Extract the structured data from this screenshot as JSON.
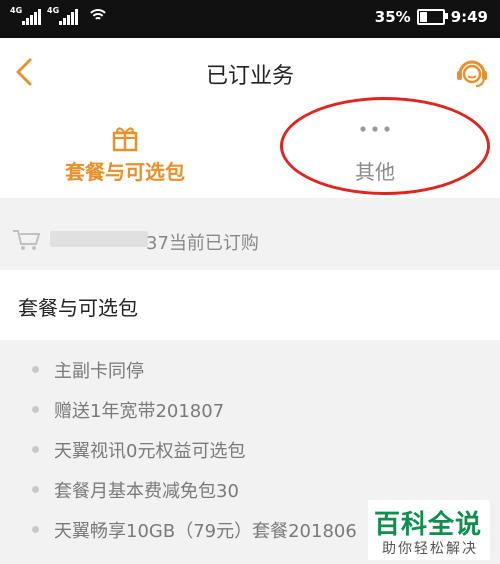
{
  "status_bar": {
    "signal1_tag": "4G",
    "signal2_tag": "4G",
    "battery_percent": "35%",
    "battery_level": 0.35,
    "time": "9:49"
  },
  "header": {
    "title": "已订业务"
  },
  "tabs": {
    "package_label": "套餐与可选包",
    "other_label": "其他"
  },
  "subscription": {
    "text": "37当前已订购"
  },
  "section": {
    "title": "套餐与可选包",
    "items": [
      "主副卡同停",
      "赠送1年宽带201807",
      "天翼视讯0元权益可选包",
      "套餐月基本费减免包30",
      "天翼畅享10GB（79元）套餐201806"
    ]
  },
  "watermark": {
    "main": "百科全说",
    "sub": "助你轻松解决"
  },
  "colors": {
    "accent": "#e8902a",
    "annotation": "#e2241f",
    "watermark": "#0f8f4e"
  },
  "icons": {
    "back": "chevron-left-icon",
    "service": "headset-icon",
    "package": "gift-box-icon",
    "other": "more-dots-icon",
    "cart": "cart-icon"
  }
}
